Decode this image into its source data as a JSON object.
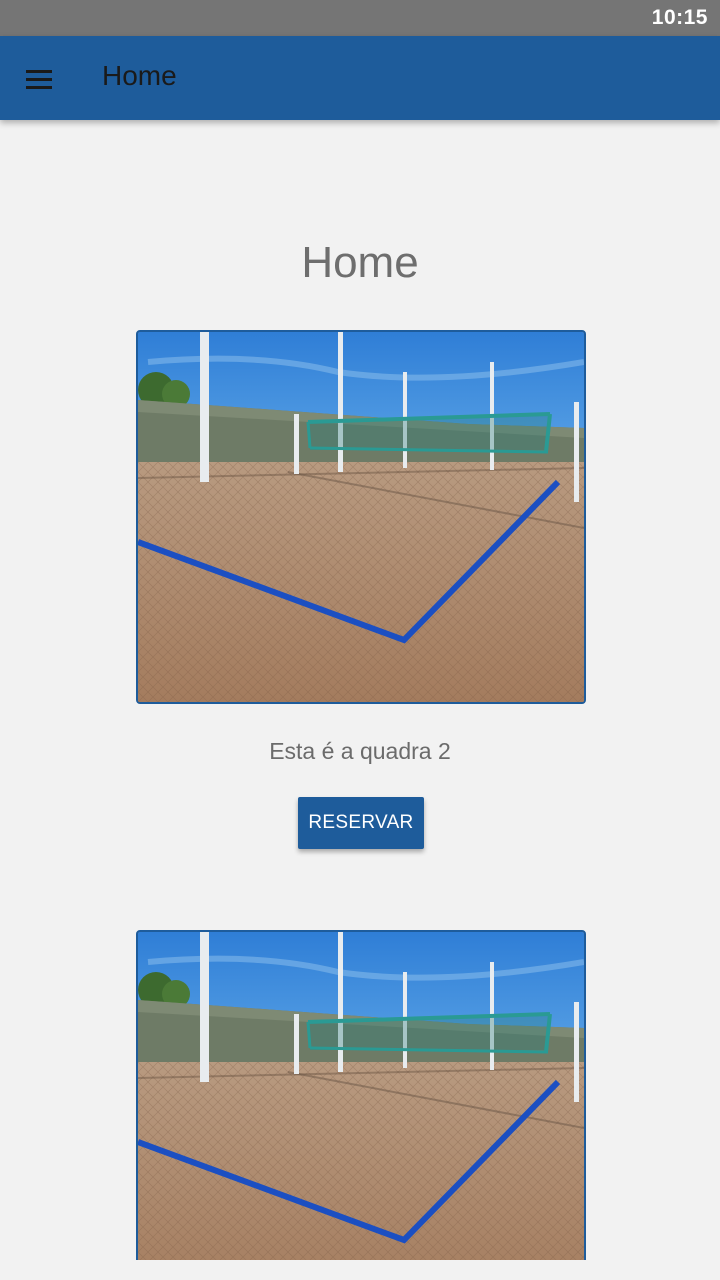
{
  "status_bar": {
    "time": "10:15"
  },
  "app_bar": {
    "title": "Home",
    "menu_icon": "hamburger-menu-icon"
  },
  "page": {
    "heading": "Home"
  },
  "courts": [
    {
      "caption": "Esta é a quadra 2",
      "button_label": "RESERVAR"
    },
    {
      "caption": "",
      "button_label": ""
    }
  ],
  "colors": {
    "app_bar": "#1e5c9b",
    "status_bar": "#757575",
    "background": "#f2f2f2",
    "court_line": "#1b4fc2"
  }
}
